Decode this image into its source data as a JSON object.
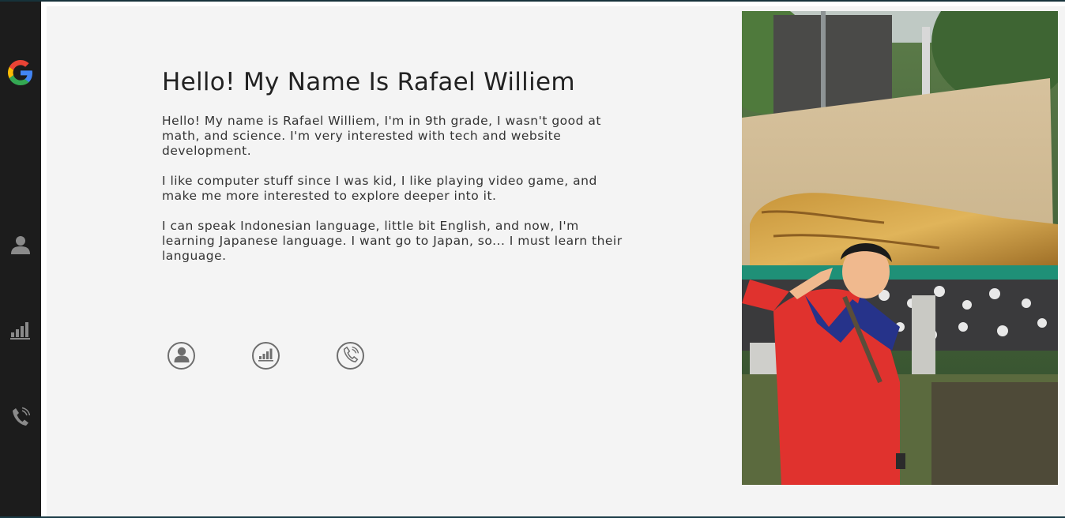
{
  "sidebar": {
    "items": [
      {
        "icon": "google-icon"
      },
      {
        "icon": "person-icon"
      },
      {
        "icon": "signal-bars-icon"
      },
      {
        "icon": "phone-icon"
      }
    ]
  },
  "main": {
    "title": "Hello! My Name Is Rafael Williem",
    "paragraphs": [
      "Hello! My name is Rafael Williem, I'm in 9th grade, I wasn't good at math, and science. I'm very interested with tech and website development.",
      "I like computer stuff since I was kid, I like playing video game, and make me more interested to explore deeper into it.",
      "I can speak Indonesian language, little bit English, and now, I'm learning Japanese language. I want go to Japan, so... I must learn their language."
    ],
    "buttons": [
      {
        "icon": "person-circle-icon"
      },
      {
        "icon": "signal-bars-circle-icon"
      },
      {
        "icon": "phone-circle-icon"
      }
    ]
  },
  "colors": {
    "sidebar_bg": "#1c1c1c",
    "panel_bg": "#f4f4f4",
    "icon_gray": "#6e6e6e",
    "title_text": "#222222"
  }
}
